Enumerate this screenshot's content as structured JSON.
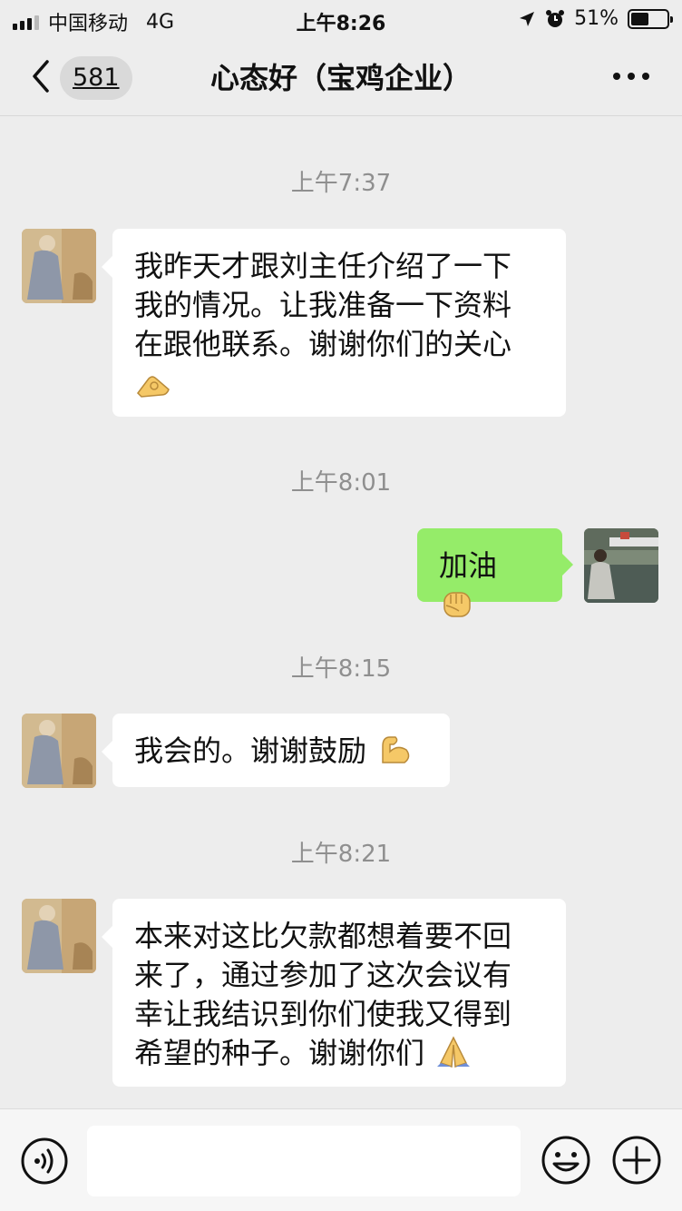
{
  "status_bar": {
    "carrier": "中国移动",
    "network": "4G",
    "time": "上午8:26",
    "battery_percent": "51%",
    "battery_level": 0.51
  },
  "nav": {
    "back_count": "581",
    "title": "心态好（宝鸡企业）"
  },
  "messages": [
    {
      "time": "上午7:37"
    },
    {
      "direction": "in",
      "lines": [
        "我昨天才跟刘主任介绍了一下",
        "我的情况。让我准备一下资料",
        "在跟他联系。谢谢你们的关心"
      ],
      "emoji": "ok-hand-icon"
    },
    {
      "time": "上午8:01"
    },
    {
      "direction": "out",
      "text": "加油",
      "emoji": "fist-icon"
    },
    {
      "time": "上午8:15"
    },
    {
      "direction": "in",
      "text": "我会的。谢谢鼓励",
      "emoji": "flexed-biceps-icon"
    },
    {
      "time": "上午8:21"
    },
    {
      "direction": "in",
      "lines": [
        "本来对这比欠款都想着要不回",
        "来了，通过参加了这次会议有",
        "幸让我结识到你们使我又得到",
        "希望的种子。谢谢你们"
      ],
      "emoji": "folded-hands-icon"
    }
  ],
  "input": {
    "value": "",
    "placeholder": ""
  },
  "colors": {
    "background": "#ededed",
    "outgoing_bubble": "#95ec69",
    "incoming_bubble": "#ffffff",
    "timestamp": "#8f8f8f"
  }
}
